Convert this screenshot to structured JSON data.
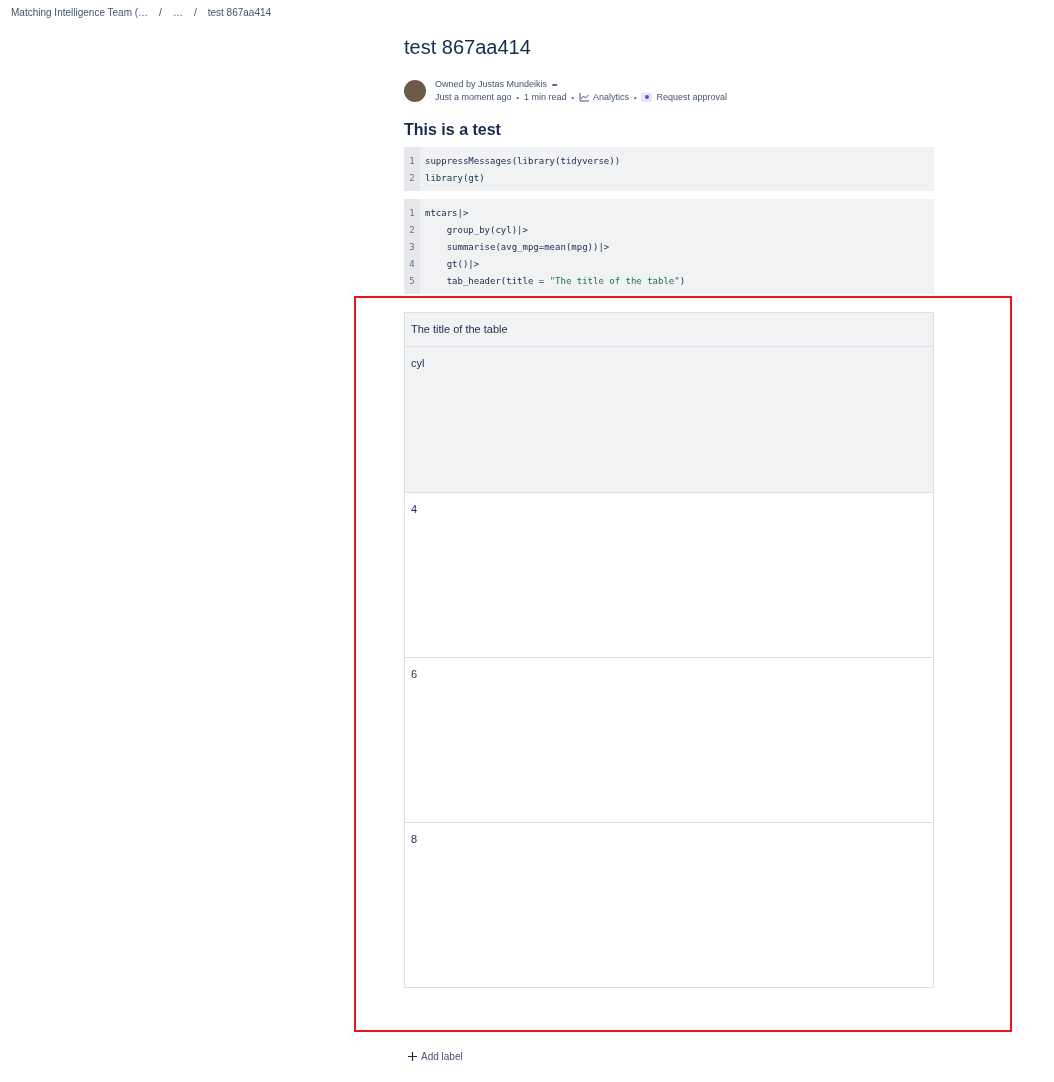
{
  "breadcrumbs": [
    {
      "label": "Matching Intelligence Team (…"
    },
    {
      "label": "…"
    },
    {
      "label": "test 867aa414"
    }
  ],
  "breadcrumb_separator": "/",
  "page": {
    "title": "test 867aa414"
  },
  "byline": {
    "owner": "Owned by Justas Mundeikis",
    "more": "•••",
    "items": [
      {
        "kind": "text",
        "label": "Just a moment ago"
      },
      {
        "kind": "text",
        "label": "1 min read"
      },
      {
        "kind": "analytics",
        "label": "Analytics"
      },
      {
        "kind": "approval",
        "label": "Request approval"
      }
    ],
    "separator": "•"
  },
  "heading": "This is a test",
  "code_blocks": [
    {
      "lines": [
        {
          "number": "1",
          "segments": [
            {
              "kind": "plain",
              "text": "suppressMessages(library(tidyverse))"
            }
          ]
        },
        {
          "number": "2",
          "segments": [
            {
              "kind": "plain",
              "text": "library(gt)"
            }
          ]
        }
      ]
    },
    {
      "lines": [
        {
          "number": "1",
          "segments": [
            {
              "kind": "plain",
              "text": "mtcars|>"
            }
          ]
        },
        {
          "number": "2",
          "segments": [
            {
              "kind": "plain",
              "text": "    group_by(cyl)|>"
            }
          ]
        },
        {
          "number": "3",
          "segments": [
            {
              "kind": "plain",
              "text": "    summarise(avg_mpg=mean(mpg))|>"
            }
          ]
        },
        {
          "number": "4",
          "segments": [
            {
              "kind": "plain",
              "text": "    gt()|>"
            }
          ]
        },
        {
          "number": "5",
          "segments": [
            {
              "kind": "plain",
              "text": "    tab_header(title = "
            },
            {
              "kind": "string",
              "text": "\"The title of the table\""
            },
            {
              "kind": "plain",
              "text": ")"
            }
          ]
        }
      ]
    }
  ],
  "table": {
    "title": "The title of the table",
    "columns": [
      "cyl"
    ],
    "rows": [
      [
        "4"
      ],
      [
        "6"
      ],
      [
        "8"
      ]
    ]
  },
  "add_label": "Add label"
}
